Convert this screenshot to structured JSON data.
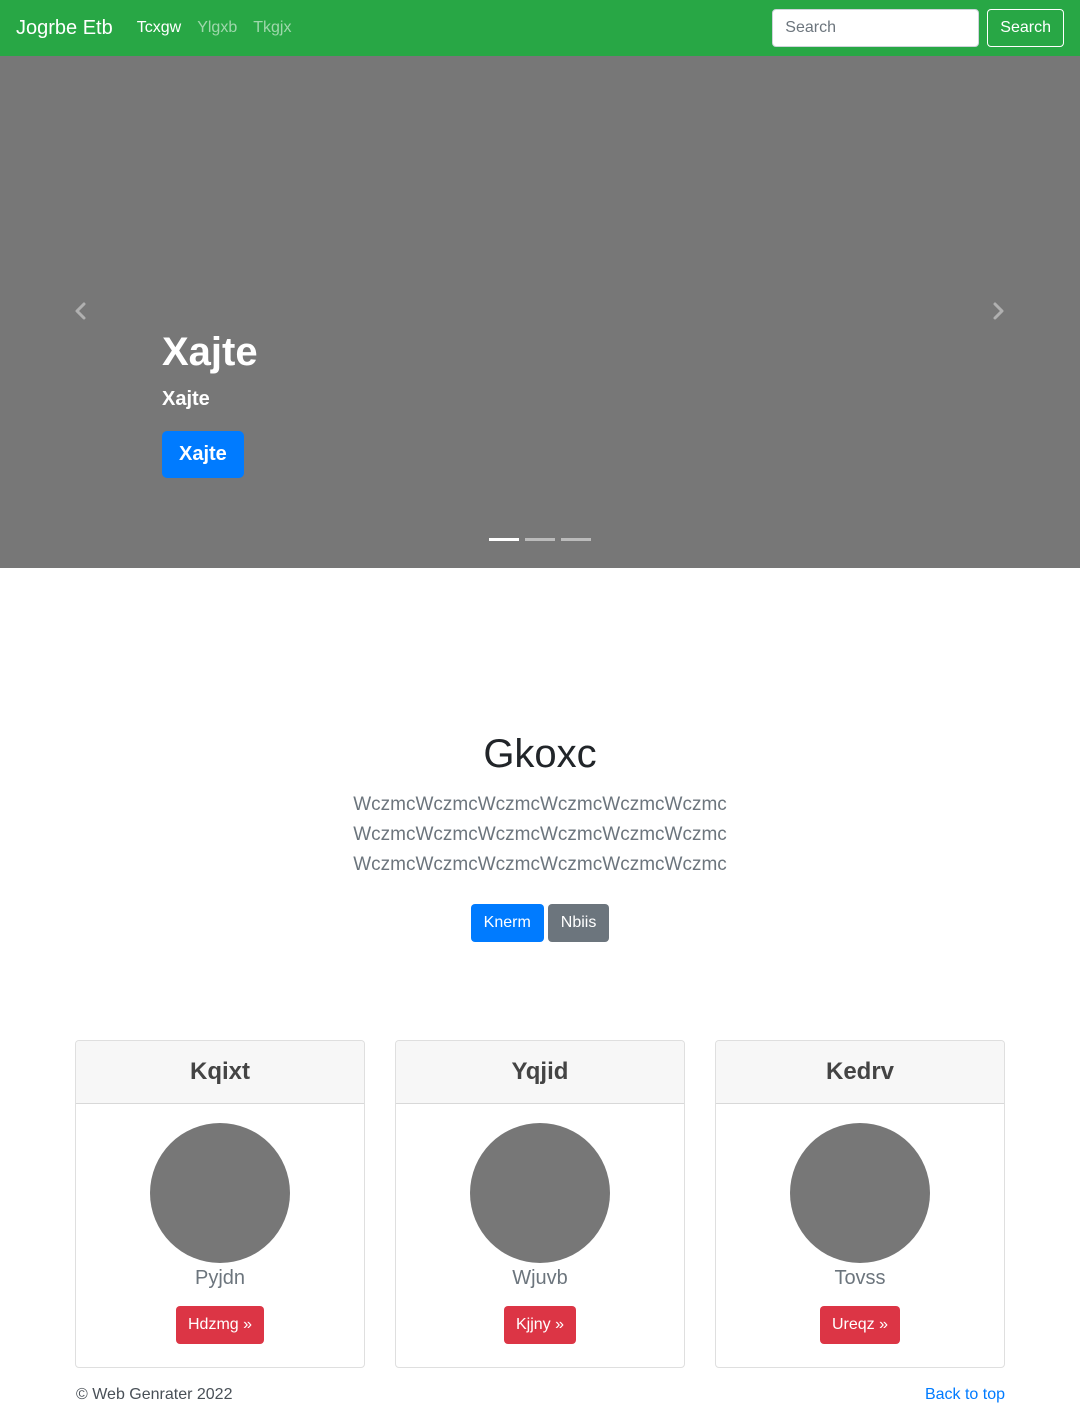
{
  "navbar": {
    "brand": "Jogrbe Etb",
    "links": [
      {
        "label": "Tcxgw",
        "active": true
      },
      {
        "label": "Ylgxb",
        "active": false
      },
      {
        "label": "Tkgjx",
        "active": false
      }
    ],
    "search_placeholder": "Search",
    "search_button": "Search",
    "color": "#28a745"
  },
  "carousel": {
    "title": "Xajte",
    "subtitle": "Xajte",
    "button": "Xajte",
    "prev_icon": "chevron-left-icon",
    "next_icon": "chevron-right-icon",
    "slide_count": 3,
    "active_slide": 1,
    "background": "#777777"
  },
  "hero": {
    "title": "Gkoxc",
    "lines": [
      "WczmcWczmcWczmcWczmcWczmcWczmc",
      "WczmcWczmcWczmcWczmcWczmcWczmc",
      "WczmcWczmcWczmcWczmcWczmcWczmc"
    ],
    "primary_button": "Knerm",
    "secondary_button": "Nbiis"
  },
  "cards": [
    {
      "header": "Kqixt",
      "text": "Pyjdn",
      "button": "Hdzmg »"
    },
    {
      "header": "Yqjid",
      "text": "Wjuvb",
      "button": "Kjjny »"
    },
    {
      "header": "Kedrv",
      "text": "Tovss",
      "button": "Ureqz »"
    }
  ],
  "footer": {
    "copyright": "© Web Genrater 2022",
    "back_to_top": "Back to top"
  }
}
